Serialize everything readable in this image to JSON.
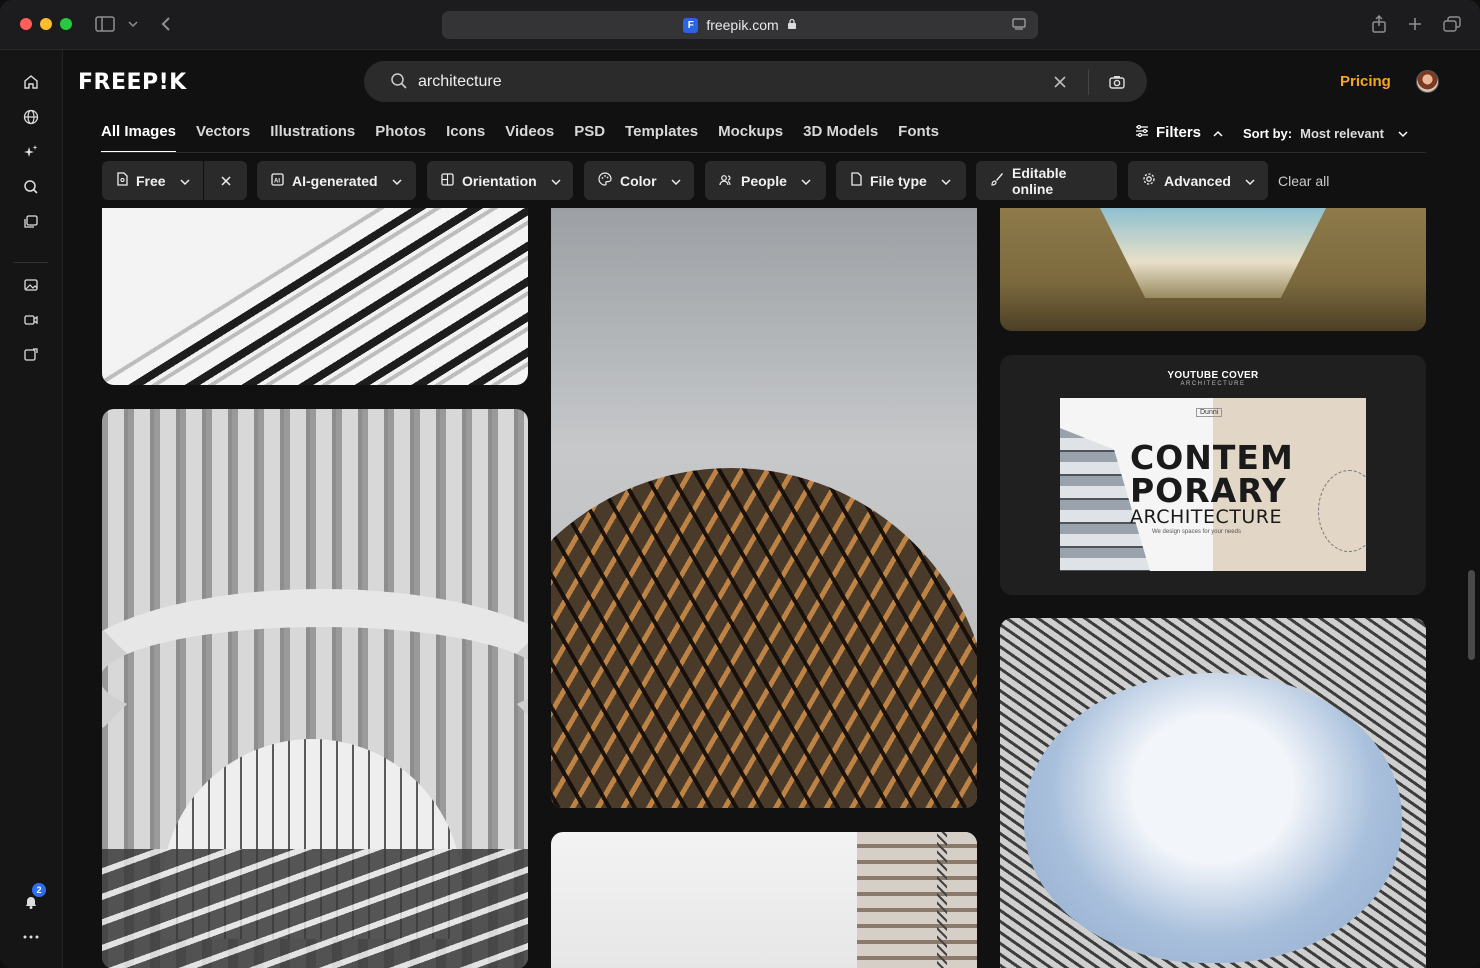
{
  "browser": {
    "url": "freepik.com",
    "favicon": "F"
  },
  "brand": {
    "logo": "FREEP!K"
  },
  "search": {
    "value": "architecture",
    "placeholder": ""
  },
  "header": {
    "pricing": "Pricing"
  },
  "tabs": [
    {
      "label": "All Images",
      "active": true
    },
    {
      "label": "Vectors"
    },
    {
      "label": "Illustrations"
    },
    {
      "label": "Photos"
    },
    {
      "label": "Icons"
    },
    {
      "label": "Videos"
    },
    {
      "label": "PSD"
    },
    {
      "label": "Templates"
    },
    {
      "label": "Mockups"
    },
    {
      "label": "3D Models"
    },
    {
      "label": "Fonts"
    }
  ],
  "filters_toggle": {
    "label": "Filters"
  },
  "sort": {
    "label": "Sort by:",
    "value": "Most relevant"
  },
  "chips": {
    "free": "Free",
    "ai": "AI-generated",
    "orientation": "Orientation",
    "color": "Color",
    "people": "People",
    "filetype": "File type",
    "editable": "Editable online",
    "advanced": "Advanced",
    "clear_all": "Clear all"
  },
  "notifications": {
    "count": "2"
  },
  "template_card": {
    "title": "YOUTUBE COVER",
    "subtitle": "ARCHITECTURE",
    "logo": "Dunni",
    "headline1": "CONTEM",
    "headline2": "PORARY",
    "headline3": "ARCHITECTURE",
    "tagline": "We design spaces for your needs"
  },
  "colors": {
    "accent": "#f5a623",
    "badge": "#2f6df6"
  }
}
